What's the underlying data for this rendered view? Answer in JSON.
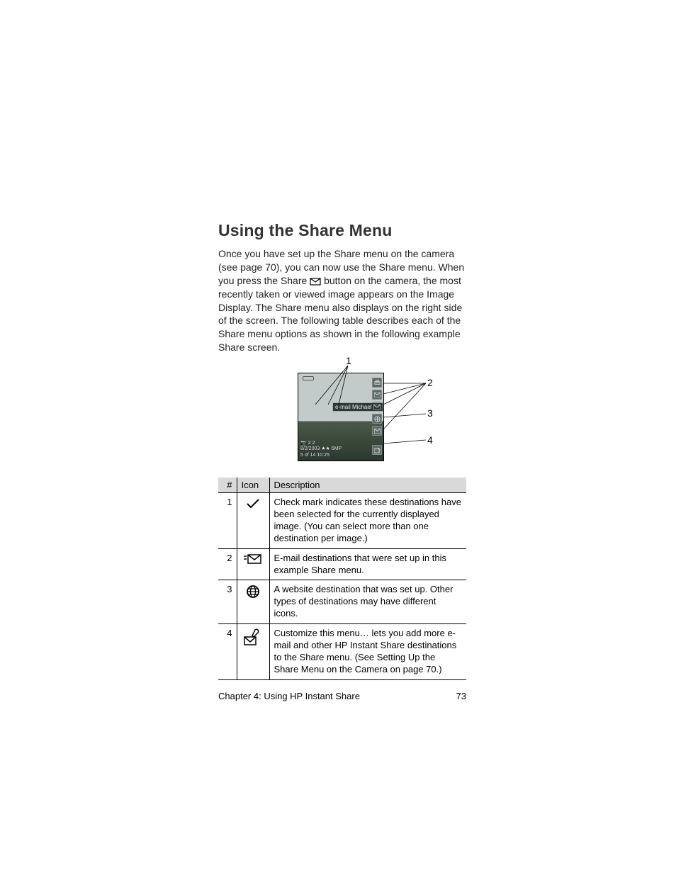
{
  "section_title": "Using the Share Menu",
  "paragraph": {
    "p1_pre": "Once you have set up the ",
    "share1": "Share",
    "p1_mid": " menu on the camera (see page 70), you can now use the ",
    "share2": "Share",
    "p1_mid2": " menu. When you press the ",
    "share3": "Share",
    "p1_mid3": " button on the camera, the most recently taken or viewed image appears on the Image Display. The ",
    "share4": "Share",
    "p1_mid4": " menu also displays on the right side of the screen. The following table describes each of the ",
    "share5": "Share",
    "p1_mid5": " menu options as shown in the following example ",
    "share6": "Share",
    "p1_end": " screen."
  },
  "figure": {
    "label": "e-mail Michael",
    "caption_line1": "2    2",
    "caption_line2": "8/2/2003 ★★ 5MP",
    "caption_line3": "5 of 14  10:25",
    "callouts": {
      "c1": "1",
      "c2": "2",
      "c3": "3",
      "c4": "4"
    }
  },
  "table": {
    "headers": {
      "num": "#",
      "icon": "Icon",
      "desc": "Description"
    },
    "rows": [
      {
        "num": "1",
        "icon": "check",
        "desc": "Check mark indicates these destinations have been selected for the currently displayed image. (You can select more than one destination per image.)"
      },
      {
        "num": "2",
        "icon": "mail",
        "desc_pre": "E-mail destinations that were set up in this example ",
        "share": "Share",
        "desc_post": " menu."
      },
      {
        "num": "3",
        "icon": "globe",
        "desc": "A website destination that was set up. Other types of destinations may have different icons."
      },
      {
        "num": "4",
        "icon": "wrench-mail",
        "desc_b1": "Customize this menu…",
        "desc_m1": " lets you add more e-mail and other ",
        "desc_b2": "HP Instant Share",
        "desc_m2": " destinations to the ",
        "desc_b3": "Share",
        "desc_m3": " menu. (See ",
        "desc_b4": "Setting Up the Share Menu on the Camera",
        "desc_m4": " on page 70.)"
      }
    ]
  },
  "footer": {
    "chapter": "Chapter 4: Using HP Instant Share",
    "page": "73"
  }
}
